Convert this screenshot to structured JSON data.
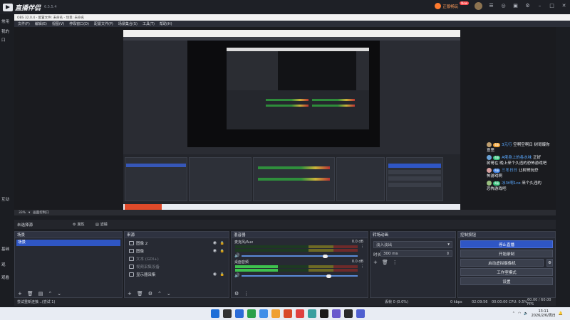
{
  "host": {
    "app_name": "直播伴侣",
    "version": "6.5.5.4",
    "vip_label": "正版畅玩",
    "new_tag": "New",
    "sidebar_left": [
      "常用",
      "我的",
      "口",
      "互动",
      "基础",
      "观",
      "观看"
    ]
  },
  "obs_window": {
    "title": "OBS 32.0.4 - 配置文件: 未命名 - 场景: 未命名",
    "menu": [
      "文件(F)",
      "编辑(E)",
      "视图(V)",
      "停靠窗口(D)",
      "配置文件(P)",
      "场景集合(S)",
      "工具(T)",
      "帮助(H)"
    ]
  },
  "chat": [
    {
      "badge": "4级",
      "name": "3元行",
      "text": "空啊空啊日 树哥爆你"
    },
    {
      "text": "意思"
    },
    {
      "badge": "4级",
      "name": "A佬身上的各水味",
      "text": "正好"
    },
    {
      "text": "树哥在 晚上来个久违的恐怖游戏吧"
    },
    {
      "badge": "4级",
      "name": "三冬日日",
      "text": "让树哥玩恐"
    },
    {
      "text": "怖游戏啊"
    },
    {
      "badge": "4级",
      "name": "冰3t啊1ce",
      "text": "来个久违的"
    },
    {
      "text": "恐怖游戏吧"
    }
  ],
  "status_top": {
    "zoom": "33%",
    "label": "画面控制口"
  },
  "scene_toolbar": {
    "label": "未选择源",
    "properties": "属性",
    "filters": "滤镜"
  },
  "scenes": {
    "title": "场景",
    "items": [
      "场景"
    ]
  },
  "sources": {
    "title": "来源",
    "items": [
      "图像 2",
      "图像",
      "文本 (GDI+)",
      "视频采集设备",
      "显示器采集"
    ]
  },
  "mixer": {
    "title": "混音器",
    "channels": [
      {
        "name": "麦克风/Aux",
        "db": "0.0 dB",
        "level": 0.0,
        "slider": 0.72
      },
      {
        "name": "桌面音频",
        "db": "0.0 dB",
        "level": 0.35,
        "slider": 0.75
      }
    ]
  },
  "transitions": {
    "title": "转场动画",
    "selected": "淡入淡出",
    "duration_label": "时长",
    "duration_value": "300 ms"
  },
  "controls": {
    "title": "控制按钮",
    "buttons": [
      "停止直播",
      "开始录制",
      "启动虚拟摄像机",
      "工作室模式",
      "设置"
    ]
  },
  "obs_status": {
    "left": "尝试重新连接...(尝试 1)",
    "dropped": "丢帧 0 (0.0%)",
    "bitrate": "0 kbps",
    "live_time": "02:09:56",
    "rec_time": "00:00:00",
    "cpu": "CPU: 0.5%",
    "fps": "60.00 / 60.00 FPS"
  },
  "taskbar": {
    "time": "13:11",
    "date": "2026/2/6/周日",
    "icon_colors": [
      "#1f6fd8",
      "#333333",
      "#2b6cd8",
      "#2aa04a",
      "#3f8ee8",
      "#f0a030",
      "#d84a2a",
      "#e04040",
      "#3aa0a0",
      "#1b1b1b",
      "#6a5acd",
      "#2a2a2a",
      "#5060d0"
    ]
  }
}
